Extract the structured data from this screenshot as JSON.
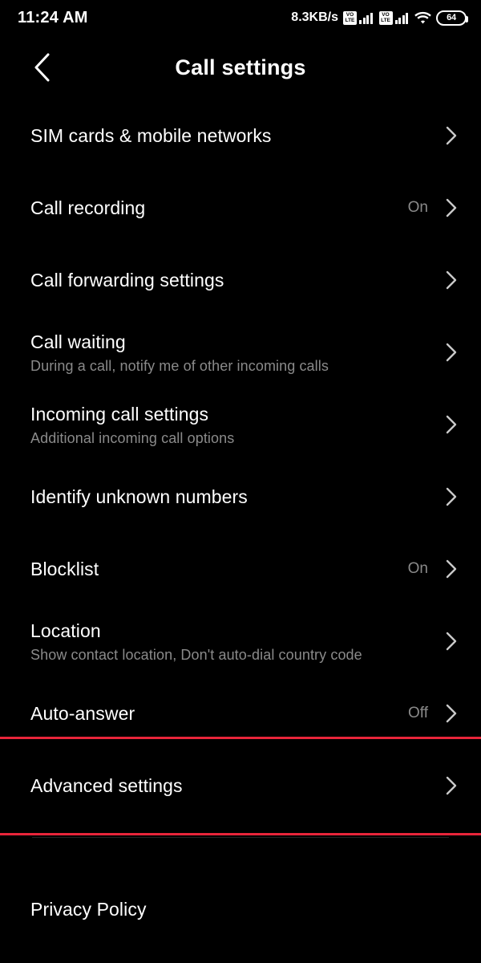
{
  "status_bar": {
    "time": "11:24 AM",
    "network_speed": "8.3KB/s",
    "sim1_icon": "volte-icon",
    "sim1_signal_icon": "signal-bars-icon",
    "sim2_icon": "volte-icon",
    "sim2_signal_icon": "signal-bars-icon",
    "volte_top": "VO",
    "volte_bottom": "LTE",
    "wifi_icon": "wifi-icon",
    "battery_level": "64"
  },
  "header": {
    "back_icon": "back-chevron-icon",
    "title": "Call settings"
  },
  "settings": {
    "items": [
      {
        "title": "SIM cards & mobile networks",
        "subtitle": "",
        "value": "",
        "highlighted": false
      },
      {
        "title": "Call recording",
        "subtitle": "",
        "value": "On",
        "highlighted": false
      },
      {
        "title": "Call forwarding settings",
        "subtitle": "",
        "value": "",
        "highlighted": false
      },
      {
        "title": "Call waiting",
        "subtitle": "During a call, notify me of other incoming calls",
        "value": "",
        "highlighted": false
      },
      {
        "title": "Incoming call settings",
        "subtitle": "Additional incoming call options",
        "value": "",
        "highlighted": false
      },
      {
        "title": "Identify unknown numbers",
        "subtitle": "",
        "value": "",
        "highlighted": false
      },
      {
        "title": "Blocklist",
        "subtitle": "",
        "value": "On",
        "highlighted": false
      },
      {
        "title": "Location",
        "subtitle": "Show contact location, Don't auto-dial country code",
        "value": "",
        "highlighted": false
      },
      {
        "title": "Auto-answer",
        "subtitle": "",
        "value": "Off",
        "highlighted": false
      },
      {
        "title": "Advanced settings",
        "subtitle": "",
        "value": "",
        "highlighted": true
      }
    ],
    "footer_item": {
      "title": "Privacy Policy"
    }
  },
  "colors": {
    "background": "#000000",
    "primary_text": "#ffffff",
    "secondary_text": "#8a8a8a",
    "highlight_border": "#e8253a",
    "divider": "#222325"
  }
}
